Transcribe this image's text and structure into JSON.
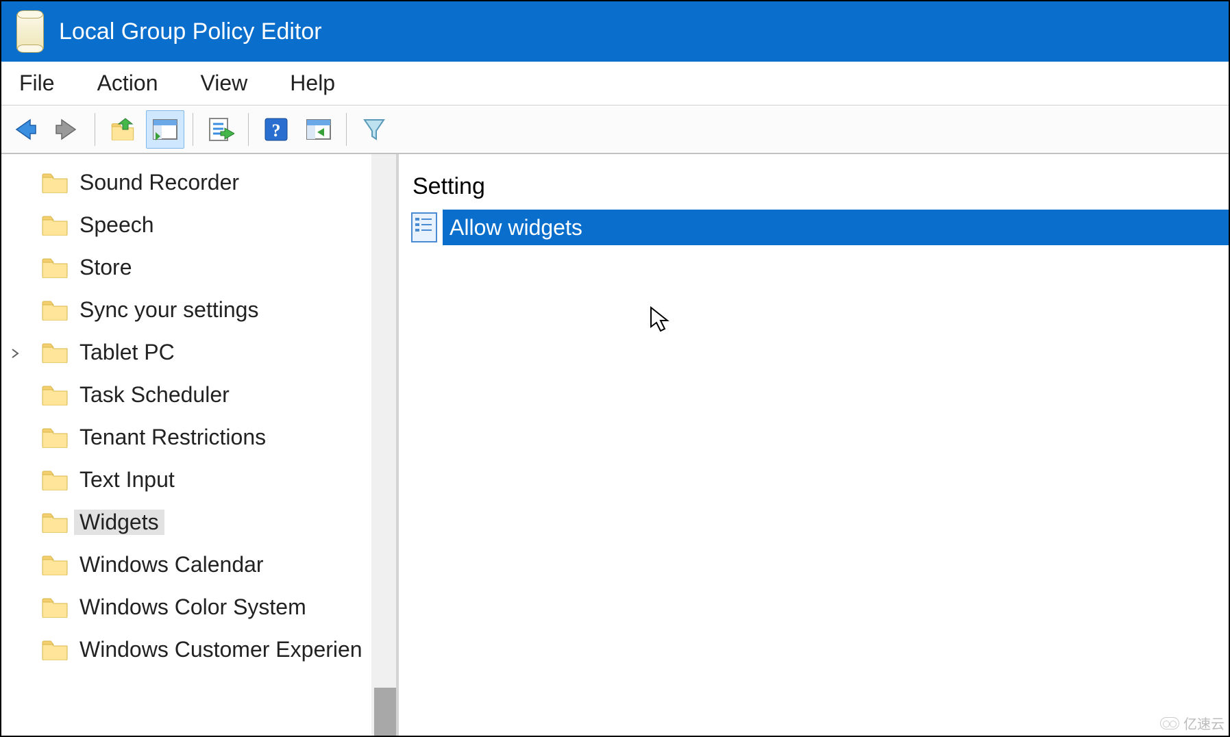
{
  "window": {
    "title": "Local Group Policy Editor"
  },
  "menu": {
    "items": [
      "File",
      "Action",
      "View",
      "Help"
    ]
  },
  "toolbar": {
    "buttons": [
      {
        "name": "back",
        "icon": "arrow-left"
      },
      {
        "name": "forward",
        "icon": "arrow-right"
      },
      {
        "name": "up",
        "icon": "folder-up"
      },
      {
        "name": "detail",
        "icon": "pane-detail",
        "active": true
      },
      {
        "name": "export",
        "icon": "list-export"
      },
      {
        "name": "help",
        "icon": "help"
      },
      {
        "name": "show",
        "icon": "pane-show"
      },
      {
        "name": "filter",
        "icon": "funnel"
      }
    ]
  },
  "tree": {
    "items": [
      {
        "label": "Sound Recorder",
        "expandable": false,
        "selected": false
      },
      {
        "label": "Speech",
        "expandable": false,
        "selected": false
      },
      {
        "label": "Store",
        "expandable": false,
        "selected": false
      },
      {
        "label": "Sync your settings",
        "expandable": false,
        "selected": false
      },
      {
        "label": "Tablet PC",
        "expandable": true,
        "selected": false
      },
      {
        "label": "Task Scheduler",
        "expandable": false,
        "selected": false
      },
      {
        "label": "Tenant Restrictions",
        "expandable": false,
        "selected": false
      },
      {
        "label": "Text Input",
        "expandable": false,
        "selected": false
      },
      {
        "label": "Widgets",
        "expandable": false,
        "selected": true
      },
      {
        "label": "Windows Calendar",
        "expandable": false,
        "selected": false
      },
      {
        "label": "Windows Color System",
        "expandable": false,
        "selected": false
      },
      {
        "label": "Windows Customer Experien",
        "expandable": false,
        "selected": false
      }
    ]
  },
  "detail": {
    "header": "Setting",
    "settings": [
      {
        "label": "Allow widgets",
        "selected": true
      }
    ]
  },
  "watermark": "亿速云"
}
